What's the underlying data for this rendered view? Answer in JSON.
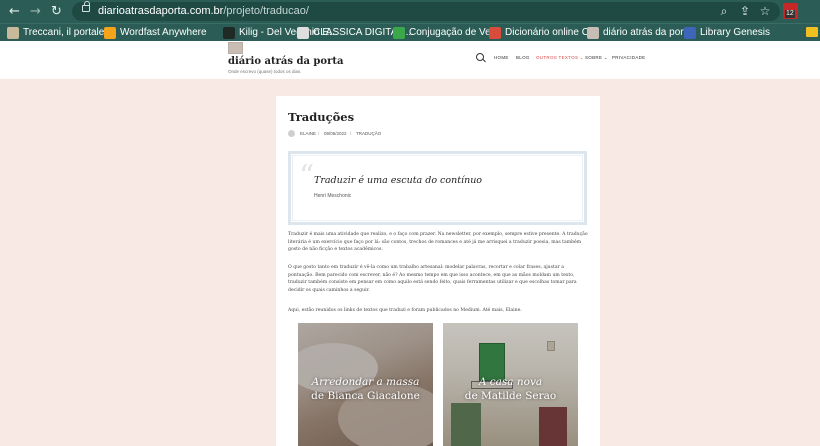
{
  "browser": {
    "url_domain": "diarioatrasdaporta.com.br",
    "url_path": "/projeto/traducao/",
    "extension_badge": "12",
    "bookmarks": [
      {
        "label": "Treccani, il portale...",
        "color": "#c7b99a"
      },
      {
        "label": "Wordfast Anywhere",
        "color": "#f3a41b"
      },
      {
        "label": "Kilig - Del Vecchio E...",
        "color": "#1f2a26"
      },
      {
        "label": "CLASSICA DIGITALI...",
        "color": "#dedede"
      },
      {
        "label": "Conjugação de Ver...",
        "color": "#3aa84a"
      },
      {
        "label": "Dicionário online C...",
        "color": "#d94b3b"
      },
      {
        "label": "diário atrás da port...",
        "color": "#c8bdb4"
      },
      {
        "label": "Library Genesis",
        "color": "#3e66b8"
      }
    ]
  },
  "site": {
    "title": "diário atrás da porta",
    "tagline": "Onde escrevo (quase) todos os dias.",
    "nav": [
      {
        "label": "HOME"
      },
      {
        "label": "BLOG"
      },
      {
        "label": "OUTROS TEXTOS ⌄"
      },
      {
        "label": "SOBRE ⌄"
      },
      {
        "label": "PRIVACIDADE"
      }
    ],
    "accent_color": "#d64a4a"
  },
  "post": {
    "title": "Traduções",
    "author": "ELAINE",
    "date": "09/06/2022",
    "category": "TRADUÇÃO",
    "quote": {
      "mark": "“",
      "text": "Traduzir é uma escuta do contínuo",
      "author": "Henri Meschonic"
    },
    "paragraphs": [
      "Traduzir é mais uma atividade que realizo, e o faço com prazer. Na newsletter, por exemplo, sempre estive presente. A tradução literária é um exercício que faço por lá: são contos, trechos de romances e até já me arrisquei a traduzir poesia, mas também gosto de não ficção e textos acadêmicos.",
      "O que gosto tanto em traduzir é vê-la como um trabalho artesanal: modelar palavras, recortar e colar frases, ajustar a pontuação. Bem parecido com escrever, não é? Ao mesmo tempo em que isso acontece, em que as mãos moldam um texto, traduzir também consiste em pensar em como aquilo está sendo feito, quais ferramentas utilizar e que escolhas tomar para decidir os quais caminhos a seguir.",
      "Aqui, estão reunidos os links de textos que traduzi e foram publicados no Medium. Até mais, Elaine."
    ],
    "cards": [
      {
        "title_line1": "Arredondar a massa",
        "title_line2": "de Bianca Giacalone"
      },
      {
        "title_line1": "A casa nova",
        "title_line2": "de Matilde Serao"
      }
    ]
  }
}
